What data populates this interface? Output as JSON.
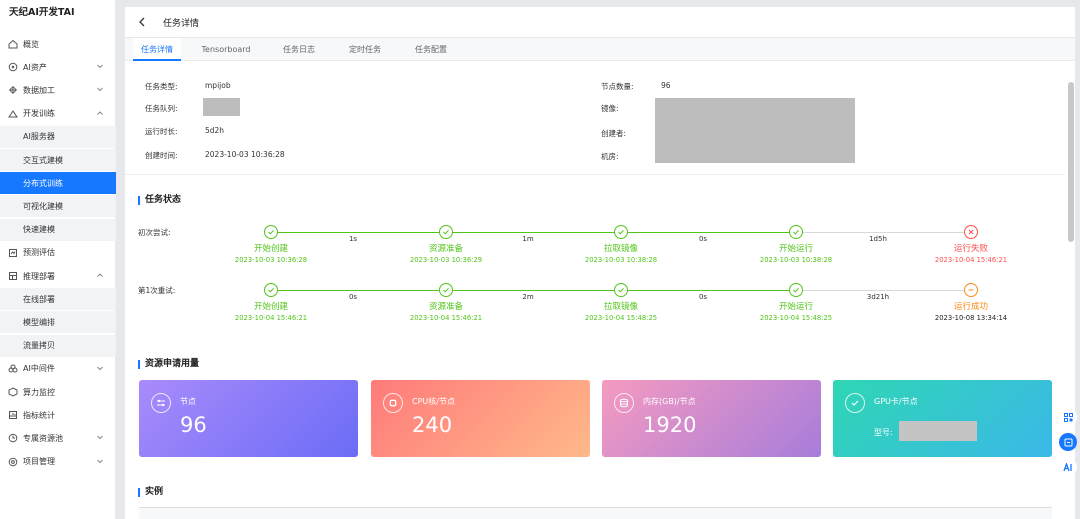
{
  "app": {
    "brand": "天纪AI开发TAI"
  },
  "sidebar": {
    "items": [
      {
        "label": "概览",
        "icon": "home-icon",
        "chev": ""
      },
      {
        "label": "AI资产",
        "icon": "asset-icon",
        "chev": "down"
      },
      {
        "label": "数据加工",
        "icon": "data-icon",
        "chev": "down"
      },
      {
        "label": "开发训练",
        "icon": "dev-icon",
        "chev": "up"
      },
      {
        "label": "AI服务器",
        "sub": true
      },
      {
        "label": "交互式建模",
        "sub": true
      },
      {
        "label": "分布式训练",
        "sub": true,
        "active": true
      },
      {
        "label": "可视化建模",
        "sub": true
      },
      {
        "label": "快速建模",
        "sub": true
      },
      {
        "label": "预测评估",
        "icon": "eval-icon",
        "chev": ""
      },
      {
        "label": "推理部署",
        "icon": "deploy-icon",
        "chev": "up"
      },
      {
        "label": "在线部署",
        "sub": true
      },
      {
        "label": "模型编排",
        "sub": true
      },
      {
        "label": "流量拷贝",
        "sub": true
      },
      {
        "label": "AI中间件",
        "icon": "middleware-icon",
        "chev": "down"
      },
      {
        "label": "算力监控",
        "icon": "monitor-icon",
        "chev": ""
      },
      {
        "label": "指标统计",
        "icon": "stats-icon",
        "chev": ""
      },
      {
        "label": "专属资源池",
        "icon": "pool-icon",
        "chev": "down"
      },
      {
        "label": "项目管理",
        "icon": "project-icon",
        "chev": "down"
      }
    ]
  },
  "header": {
    "title": "任务详情"
  },
  "tabs": [
    "任务详情",
    "Tensorboard",
    "任务日志",
    "定时任务",
    "任务配置"
  ],
  "info": {
    "type_label": "任务类型:",
    "type_value": "mpijob",
    "queue_label": "任务队列:",
    "runtime_label": "运行时长:",
    "runtime_value": "5d2h",
    "created_label": "创建时间:",
    "created_value": "2023-10-03 10:36:28",
    "nodes_label": "节点数量:",
    "nodes_value": "96",
    "image_label": "镜像:",
    "creator_label": "创建者:",
    "room_label": "机房:"
  },
  "status": {
    "title": "任务状态",
    "rows": [
      {
        "label": "初次尝试:",
        "steps": [
          {
            "name": "开始创建",
            "time": "2023-10-03 10:36:28",
            "state": "ok"
          },
          {
            "name": "资源准备",
            "time": "2023-10-03 10:36:29",
            "state": "ok"
          },
          {
            "name": "拉取镜像",
            "time": "2023-10-03 10:38:28",
            "state": "ok"
          },
          {
            "name": "开始运行",
            "time": "2023-10-03 10:38:28",
            "state": "ok"
          },
          {
            "name": "运行失败",
            "time": "2023-10-04 15:46:21",
            "state": "fail"
          }
        ],
        "durations": [
          "1s",
          "1m",
          "0s",
          "1d5h"
        ]
      },
      {
        "label": "第1次重试:",
        "steps": [
          {
            "name": "开始创建",
            "time": "2023-10-04 15:46:21",
            "state": "ok"
          },
          {
            "name": "资源准备",
            "time": "2023-10-04 15:46:21",
            "state": "ok"
          },
          {
            "name": "拉取镜像",
            "time": "2023-10-04 15:48:25",
            "state": "ok"
          },
          {
            "name": "开始运行",
            "time": "2023-10-04 15:48:25",
            "state": "ok"
          },
          {
            "name": "运行成功",
            "time": "2023-10-08 13:34:14",
            "state": "pending"
          }
        ],
        "durations": [
          "0s",
          "2m",
          "0s",
          "3d21h"
        ]
      }
    ]
  },
  "resources": {
    "title": "资源申请用量",
    "cards": [
      {
        "label": "节点",
        "value": "96",
        "icon": "sliders-icon"
      },
      {
        "label": "CPU核/节点",
        "value": "240",
        "icon": "cpu-icon"
      },
      {
        "label": "内存(GB)/节点",
        "value": "1920",
        "icon": "database-icon"
      },
      {
        "label": "GPU卡/节点",
        "model_label": "型号:",
        "icon": "check-circle-icon"
      }
    ]
  },
  "instances": {
    "title": "实例"
  },
  "colors": {
    "primary": "#1677ff",
    "success": "#52c41a",
    "fail": "#ff4d4f",
    "pending": "#fa8c16"
  }
}
